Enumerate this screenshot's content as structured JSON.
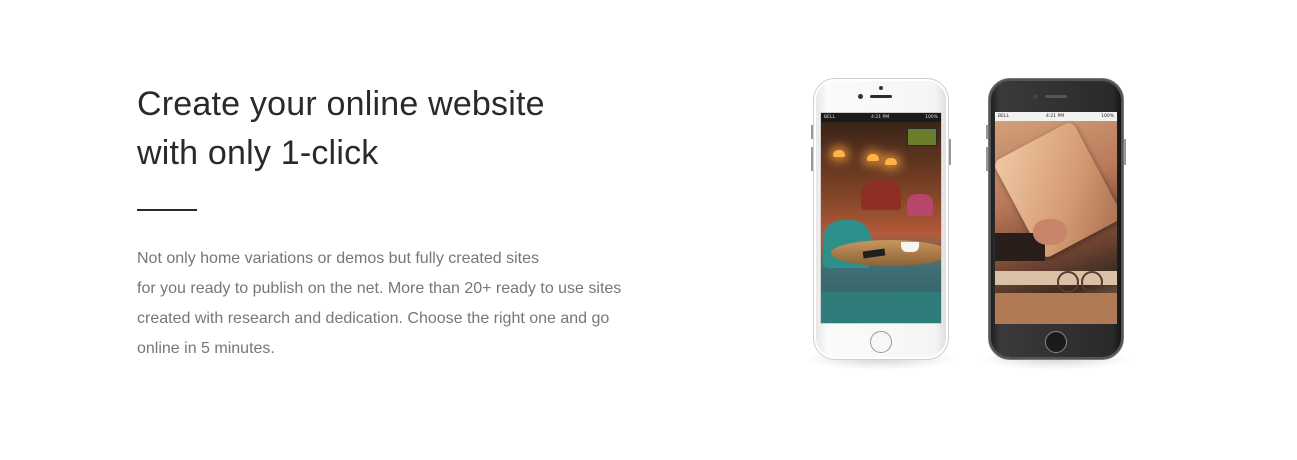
{
  "hero": {
    "title_line1": "Create your online website",
    "title_line2": "with only 1-click",
    "body_lines": [
      "Not only home variations or demos but fully created sites",
      "for you ready to publish on the net. More than 20+ ready to use sites",
      "created with research and dedication. Choose the right one and go",
      "online in 5 minutes."
    ]
  },
  "phones": {
    "white": {
      "carrier": "BELL",
      "time": "4:21 PM",
      "battery": "100%"
    },
    "black": {
      "carrier": "BELL",
      "time": "4:21 PM",
      "battery": "100%"
    }
  },
  "colors": {
    "heading": "#2a2a2a",
    "body_text": "#777777",
    "background": "#ffffff"
  }
}
